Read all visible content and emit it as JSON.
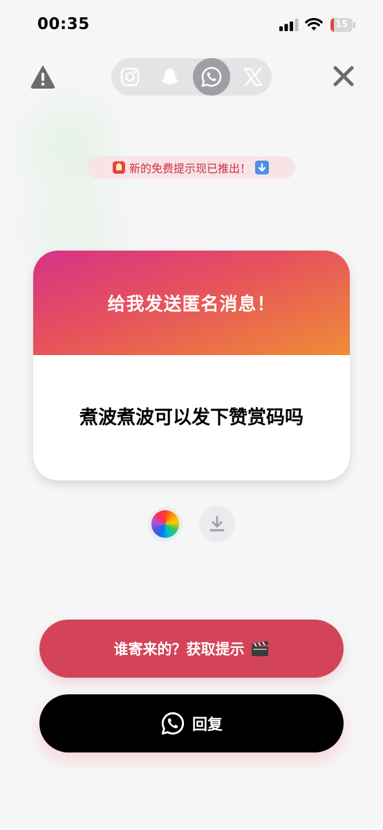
{
  "status_bar": {
    "time": "00:35",
    "battery_level": "15",
    "battery_color": "#e0463e"
  },
  "top_bar": {
    "warning_icon": "warning-icon",
    "close_icon": "close-icon",
    "platforms": [
      {
        "name": "instagram",
        "icon": "instagram-icon",
        "active": false
      },
      {
        "name": "snapchat",
        "icon": "snapchat-icon",
        "active": false
      },
      {
        "name": "whatsapp",
        "icon": "whatsapp-icon",
        "active": true
      },
      {
        "name": "x",
        "icon": "x-icon",
        "active": false
      }
    ]
  },
  "notice": {
    "text": "新的免费提示现已推出！",
    "leading_icon": "siren-emoji",
    "trailing_icon": "down-arrow-emoji"
  },
  "card": {
    "title": "给我发送匿名消息！",
    "message": "煮波煮波可以发下赞赏码吗",
    "gradient": [
      "#d63386",
      "#e6525c",
      "#f08c36"
    ]
  },
  "actions": {
    "color_picker_icon": "color-wheel-icon",
    "download_icon": "download-icon"
  },
  "buttons": {
    "hint_label": "谁寄来的？获取提示",
    "hint_icon": "clapper-board-emoji",
    "hint_color": "#d44459",
    "reply_label": "回复",
    "reply_icon": "whatsapp-icon"
  }
}
